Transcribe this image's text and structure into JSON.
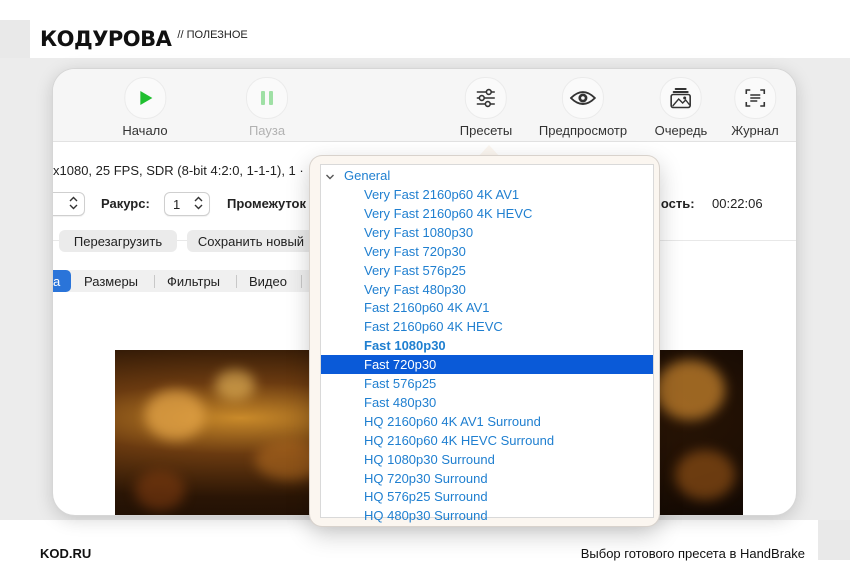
{
  "brand": {
    "logo": "КОДУРОВА",
    "tag": "// ПОЛЕЗНОЕ"
  },
  "toolbar": {
    "start_label": "Начало",
    "pause_label": "Пауза",
    "presets_label": "Пресеты",
    "preview_label": "Предпросмотр",
    "queue_label": "Очередь",
    "log_label": "Журнал"
  },
  "source": {
    "info": "x1080, 25 FPS, SDR (8-bit 4:2:0, 1-1-1), 1 ·",
    "angle_label": "Ракурс:",
    "angle_value": "1",
    "range_label": "Промежуток",
    "duration_label": "ность:",
    "duration_value": "00:22:06"
  },
  "buttons": {
    "reload": "Перезагрузить",
    "save_new": "Сохранить новый"
  },
  "tabs": [
    "а",
    "Размеры",
    "Фильтры",
    "Видео"
  ],
  "presets_menu": {
    "group": "General",
    "items": [
      "Very Fast 2160p60 4K AV1",
      "Very Fast 2160p60 4K HEVC",
      "Very Fast 1080p30",
      "Very Fast 720p30",
      "Very Fast 576p25",
      "Very Fast 480p30",
      "Fast 2160p60 4K AV1",
      "Fast 2160p60 4K HEVC",
      "Fast 1080p30",
      "Fast 720p30",
      "Fast 576p25",
      "Fast 480p30",
      "HQ 2160p60 4K AV1 Surround",
      "HQ 2160p60 4K HEVC Surround",
      "HQ 1080p30 Surround",
      "HQ 720p30 Surround",
      "HQ 576p25 Surround",
      "HQ 480p30 Surround"
    ],
    "bold_item": "Fast 1080p30",
    "selected_item": "Fast 720p30"
  },
  "footer": {
    "site": "KOD.RU",
    "caption": "Выбор готового пресета в HandBrake"
  },
  "colors": {
    "accent": "#0a5ad8",
    "link": "#1f7fd0",
    "play": "#1fbf2f",
    "pause": "#9fe0a5"
  },
  "icons": [
    "play-icon",
    "pause-icon",
    "sliders-icon",
    "eye-icon",
    "photo-stack-icon",
    "log-icon",
    "chevron-updown-icon",
    "chevron-down-icon"
  ]
}
